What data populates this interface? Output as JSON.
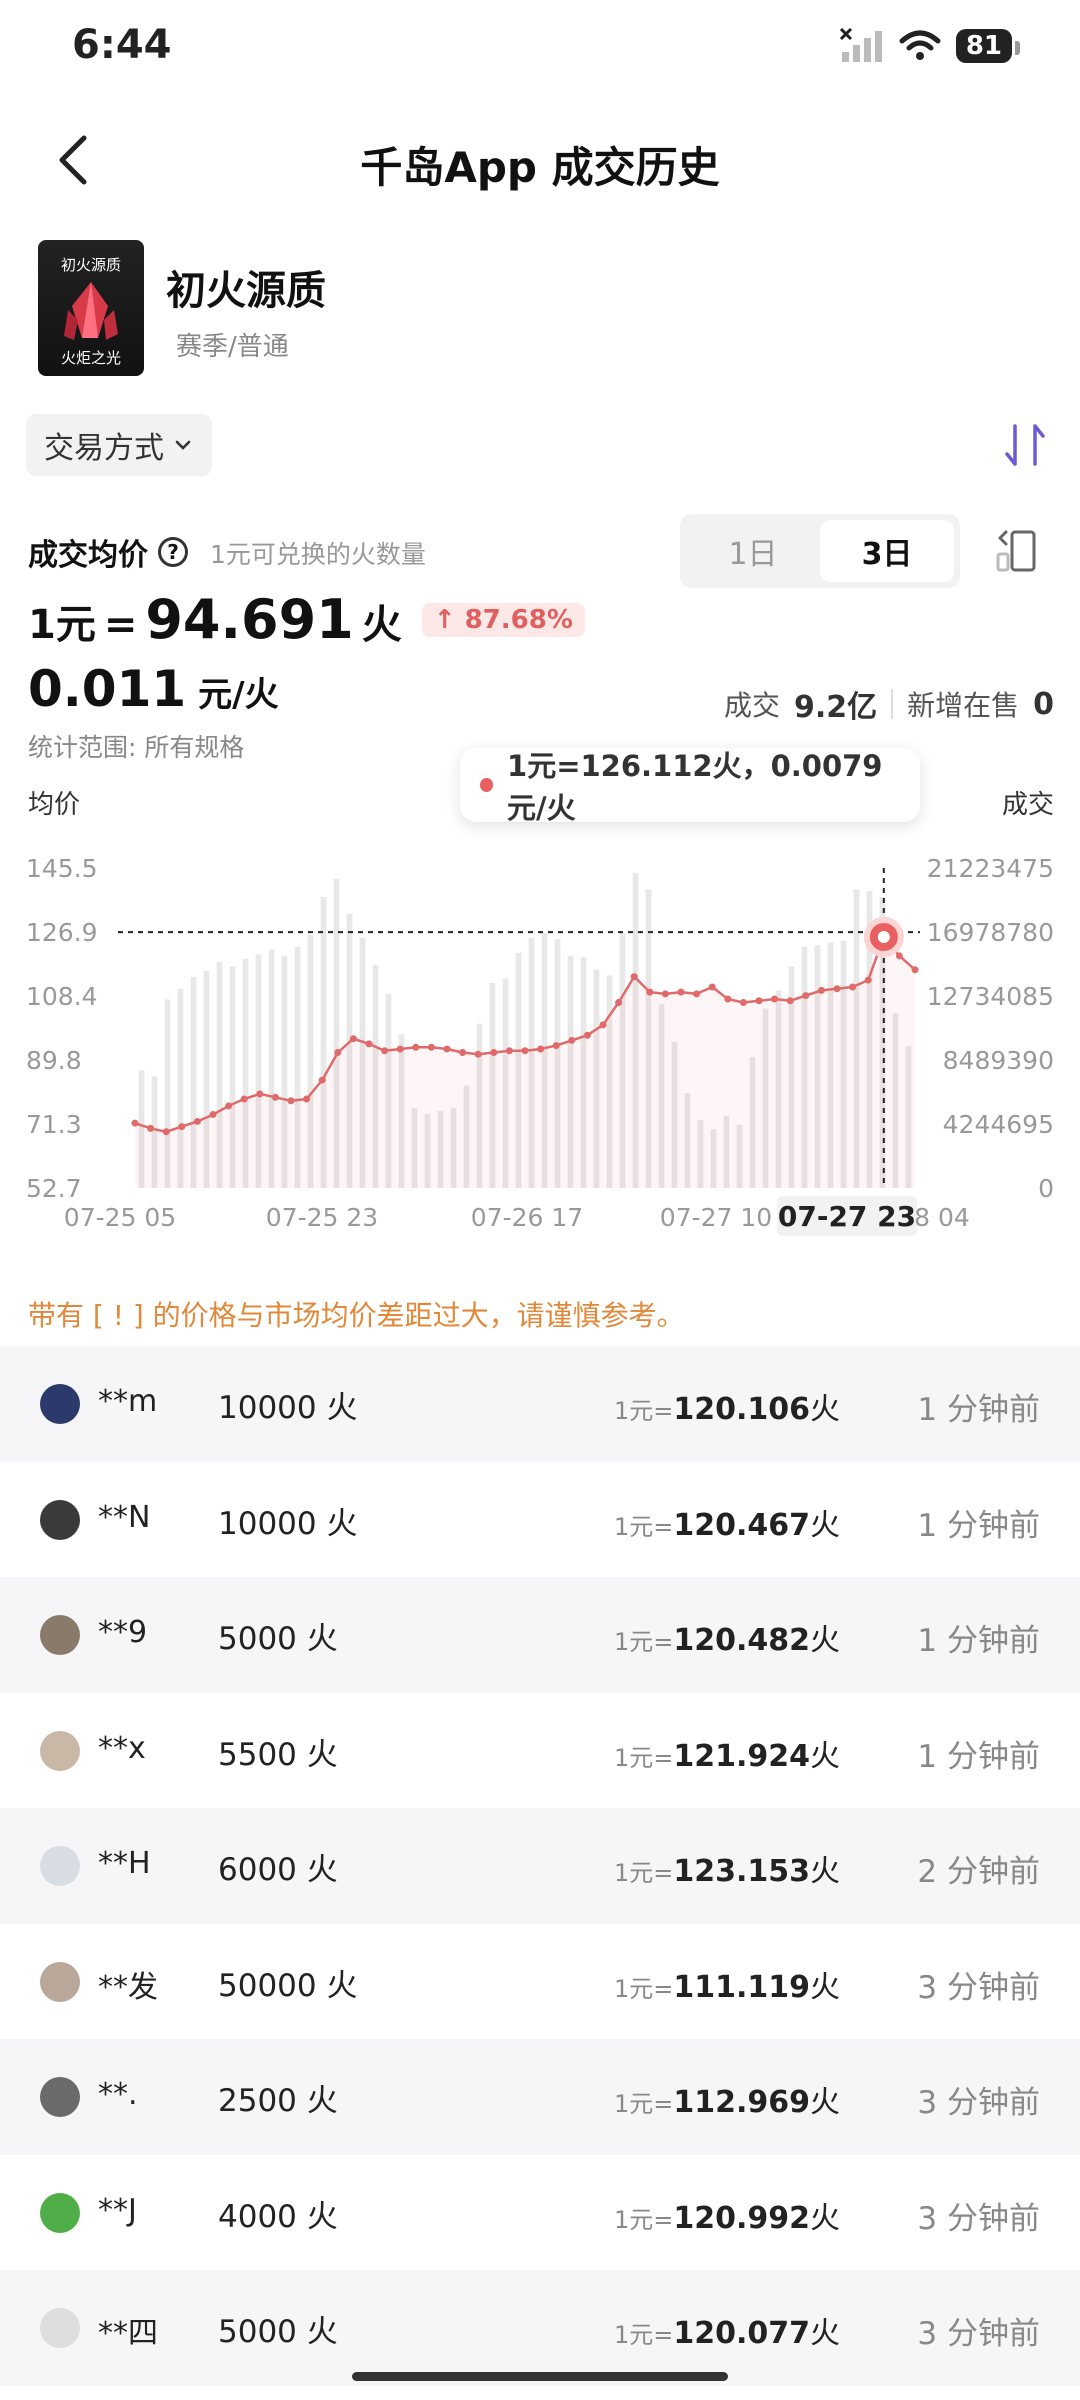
{
  "status": {
    "time": "6:44",
    "battery": "81"
  },
  "nav": {
    "title": "千岛App 成交历史"
  },
  "item": {
    "name": "初火源质",
    "sub": "赛季/普通",
    "thumb_top": "初火源质",
    "thumb_bottom": "火炬之光"
  },
  "filter": {
    "label": "交易方式"
  },
  "avg": {
    "label": "成交均价",
    "hint": "1元可兑换的火数量",
    "unit_prefix": "1元",
    "eq": "=",
    "value": "94.691",
    "unit_suffix": "火",
    "change": "↑ 87.68%",
    "per_value": "0.011",
    "per_unit": "元/火",
    "scope": "统计范围: 所有规格"
  },
  "segment": {
    "options": [
      "1日",
      "3日"
    ],
    "active": "3日"
  },
  "deal": {
    "label": "成交",
    "value": "9.2亿",
    "new_label": "新增在售",
    "new_value": "0"
  },
  "tooltip": {
    "text": "1元=126.112火，0.0079元/火"
  },
  "chart_data": {
    "type": "line",
    "left_axis_title": "均价",
    "right_axis_title": "成交",
    "y_left_ticks": [
      "145.5",
      "126.9",
      "108.4",
      "89.8",
      "71.3",
      "52.7"
    ],
    "y_left_range": [
      52.7,
      145.5
    ],
    "y_right_ticks": [
      "21223475",
      "16978780",
      "12734085",
      "8489390",
      "4244695",
      "0"
    ],
    "y_right_range": [
      0,
      21223475
    ],
    "x_ticks": [
      "07-25 05",
      "07-25 23",
      "07-26 17",
      "07-27 10",
      "07-27 23",
      "8 04"
    ],
    "highlight_tick": "07-27 23",
    "series": [
      {
        "name": "均价",
        "values": [
          71.5,
          70.0,
          69.0,
          70.5,
          72.0,
          74.0,
          76.5,
          78.5,
          80.0,
          79.0,
          78.0,
          78.5,
          84.0,
          92.0,
          96.0,
          94.5,
          92.5,
          93.0,
          93.5,
          93.5,
          93.0,
          92.0,
          91.5,
          92.0,
          92.5,
          92.5,
          93.0,
          94.0,
          95.5,
          97.0,
          100.0,
          106.5,
          114.0,
          109.5,
          109.0,
          109.5,
          109.0,
          111.0,
          107.5,
          106.5,
          107.0,
          107.5,
          107.0,
          108.5,
          110.0,
          110.5,
          111.0,
          113.0,
          125.5,
          120.0,
          116.0
        ]
      },
      {
        "name": "成交",
        "values": [
          7800000,
          7400000,
          12500000,
          13200000,
          14000000,
          14400000,
          15000000,
          14700000,
          15200000,
          15500000,
          15800000,
          15400000,
          16000000,
          16800000,
          19300000,
          20500000,
          18200000,
          16600000,
          14800000,
          12900000,
          10200000,
          5300000,
          4900000,
          5100000,
          5300000,
          6800000,
          10900000,
          13600000,
          13900000,
          15600000,
          16600000,
          16900000,
          16500000,
          15400000,
          15300000,
          14500000,
          14100000,
          16900000,
          20900000,
          19800000,
          12200000,
          9700000,
          6300000,
          4500000,
          3900000,
          4800000,
          4200000,
          8700000,
          11900000,
          13100000,
          14700000,
          16000000,
          16100000,
          16300000,
          16400000,
          19800000,
          19700000,
          19300000,
          11600000,
          9400000
        ]
      }
    ],
    "reference_value": 126.9,
    "cursor_index": 48
  },
  "warning": "带有 [ ! ] 的价格与市场均价差距过大，请谨慎参考。",
  "trades": [
    {
      "user": "**m",
      "qty": "10000 火",
      "pre": "1元=",
      "rate": "120.106",
      "unit": "火",
      "time": "1 分钟前",
      "avatar": "#2b3a6a"
    },
    {
      "user": "**N",
      "qty": "10000 火",
      "pre": "1元=",
      "rate": "120.467",
      "unit": "火",
      "time": "1 分钟前",
      "avatar": "#3a3a3a"
    },
    {
      "user": "**9",
      "qty": "5000 火",
      "pre": "1元=",
      "rate": "120.482",
      "unit": "火",
      "time": "1 分钟前",
      "avatar": "#8a7a6a"
    },
    {
      "user": "**x",
      "qty": "5500 火",
      "pre": "1元=",
      "rate": "121.924",
      "unit": "火",
      "time": "1 分钟前",
      "avatar": "#c9b8a6"
    },
    {
      "user": "**H",
      "qty": "6000 火",
      "pre": "1元=",
      "rate": "123.153",
      "unit": "火",
      "time": "2 分钟前",
      "avatar": "#d8dde3"
    },
    {
      "user": "**发",
      "qty": "50000 火",
      "pre": "1元=",
      "rate": "111.119",
      "unit": "火",
      "time": "3 分钟前",
      "avatar": "#b9a89a"
    },
    {
      "user": "**.",
      "qty": "2500 火",
      "pre": "1元=",
      "rate": "112.969",
      "unit": "火",
      "time": "3 分钟前",
      "avatar": "#6a6a6a"
    },
    {
      "user": "**J",
      "qty": "4000 火",
      "pre": "1元=",
      "rate": "120.992",
      "unit": "火",
      "time": "3 分钟前",
      "avatar": "#4fae48"
    },
    {
      "user": "**四",
      "qty": "5000 火",
      "pre": "1元=",
      "rate": "120.077",
      "unit": "火",
      "time": "3 分钟前",
      "avatar": "#dddddd"
    }
  ]
}
